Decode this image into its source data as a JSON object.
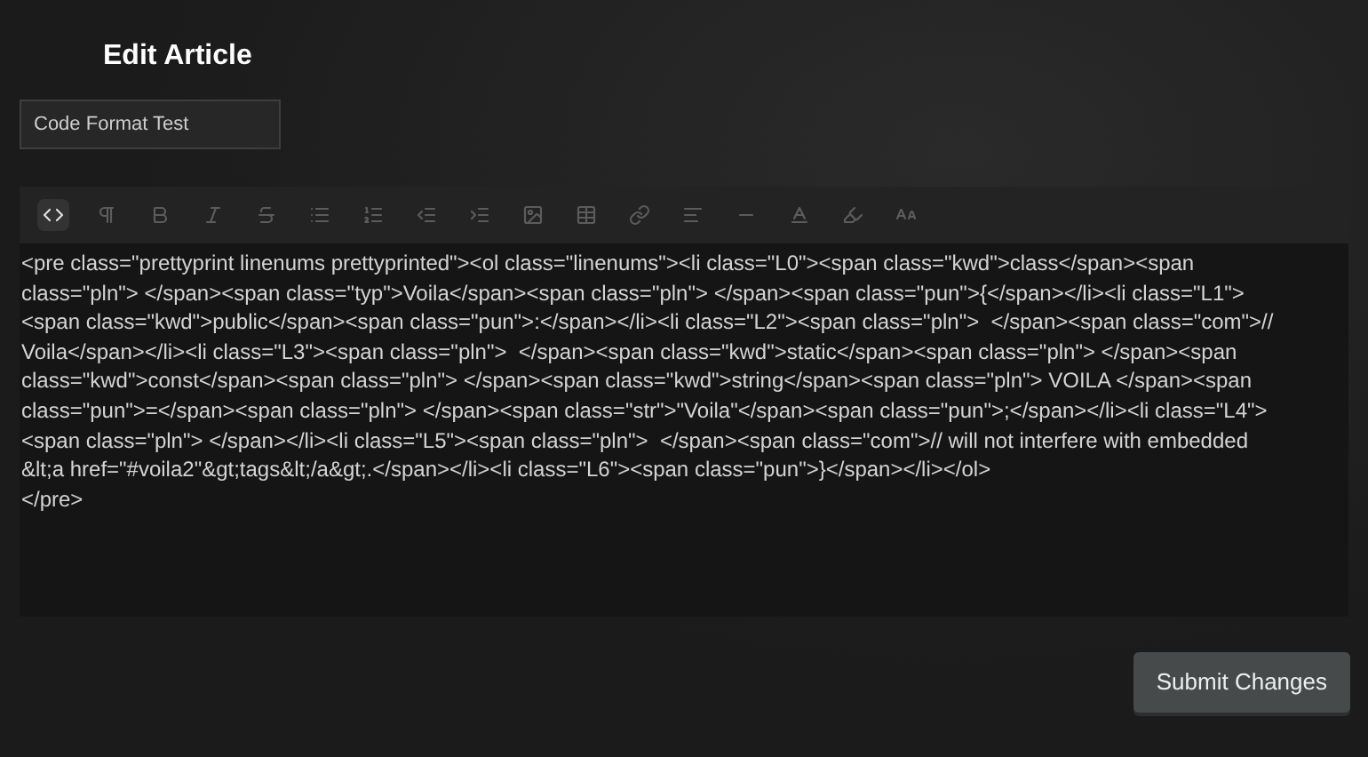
{
  "page": {
    "title": "Edit Article"
  },
  "title_field": {
    "value": "Code Format Test"
  },
  "toolbar": [
    {
      "kind": "code",
      "selected": true
    },
    {
      "kind": "paragraph",
      "selected": false
    },
    {
      "kind": "bold",
      "selected": false
    },
    {
      "kind": "italic",
      "selected": false
    },
    {
      "kind": "strikethrough",
      "selected": false
    },
    {
      "kind": "bullet-list",
      "selected": false
    },
    {
      "kind": "numbered-list",
      "selected": false
    },
    {
      "kind": "outdent",
      "selected": false
    },
    {
      "kind": "indent",
      "selected": false
    },
    {
      "kind": "image",
      "selected": false
    },
    {
      "kind": "table",
      "selected": false
    },
    {
      "kind": "link",
      "selected": false
    },
    {
      "kind": "align",
      "selected": false
    },
    {
      "kind": "rule",
      "selected": false
    },
    {
      "kind": "font-color",
      "selected": false
    },
    {
      "kind": "highlight",
      "selected": false
    },
    {
      "kind": "font-size",
      "selected": false
    }
  ],
  "editor": {
    "value": "<pre class=\"prettyprint linenums prettyprinted\"><ol class=\"linenums\"><li class=\"L0\"><span class=\"kwd\">class</span><span class=\"pln\"> </span><span class=\"typ\">Voila</span><span class=\"pln\"> </span><span class=\"pun\">{</span></li><li class=\"L1\"><span class=\"kwd\">public</span><span class=\"pun\">:</span></li><li class=\"L2\"><span class=\"pln\">  </span><span class=\"com\">// Voila</span></li><li class=\"L3\"><span class=\"pln\">  </span><span class=\"kwd\">static</span><span class=\"pln\"> </span><span class=\"kwd\">const</span><span class=\"pln\"> </span><span class=\"kwd\">string</span><span class=\"pln\"> VOILA </span><span class=\"pun\">=</span><span class=\"pln\"> </span><span class=\"str\">\"Voila\"</span><span class=\"pun\">;</span></li><li class=\"L4\"><span class=\"pln\"> </span></li><li class=\"L5\"><span class=\"pln\">  </span><span class=\"com\">// will not interfere with embedded &lt;a href=\"#voila2\"&gt;tags&lt;/a&gt;.</span></li><li class=\"L6\"><span class=\"pun\">}</span></li></ol>\n</pre>"
  },
  "submit_button": {
    "label": "Submit Changes"
  }
}
